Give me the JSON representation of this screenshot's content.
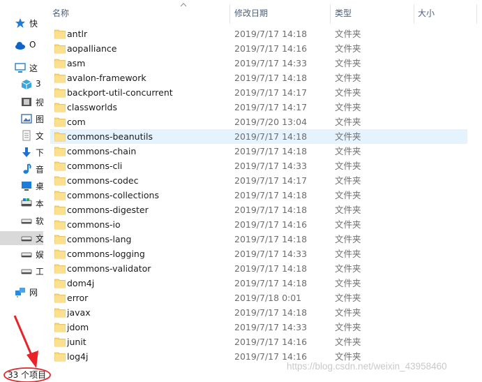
{
  "nav": {
    "items": [
      {
        "label": "快",
        "icon": "star-pin-icon",
        "color": "#1e7dd8"
      },
      {
        "label": "O",
        "icon": "onedrive-cloud-icon",
        "color": "#0f63c9"
      },
      {
        "label": "这",
        "icon": "this-pc-icon",
        "color": "#2b89d8"
      },
      {
        "label": "3",
        "icon": "3d-objects-icon",
        "color": "#39a5d8"
      },
      {
        "label": "视",
        "icon": "video-icon",
        "color": "#555555"
      },
      {
        "label": "图",
        "icon": "pictures-icon",
        "color": "#4a78b8"
      },
      {
        "label": "文",
        "icon": "documents-icon",
        "color": "#8c8c8c"
      },
      {
        "label": "下",
        "icon": "downloads-arrow-icon",
        "color": "#1e6fcf"
      },
      {
        "label": "音",
        "icon": "music-note-icon",
        "color": "#1e7dd8"
      },
      {
        "label": "桌",
        "icon": "desktop-icon",
        "color": "#1e7dd8"
      },
      {
        "label": "本",
        "icon": "local-disk-icon",
        "color": "#6d6d6d"
      },
      {
        "label": "软",
        "icon": "drive-icon",
        "color": "#6d6d6d"
      },
      {
        "label": "文",
        "icon": "drive-icon",
        "color": "#6d6d6d"
      },
      {
        "label": "娱",
        "icon": "drive-icon",
        "color": "#6d6d6d"
      },
      {
        "label": "工",
        "icon": "drive-icon",
        "color": "#6d6d6d"
      },
      {
        "label": "网",
        "icon": "network-icon",
        "color": "#2b89d8"
      }
    ]
  },
  "header": {
    "name": "名称",
    "date": "修改日期",
    "type": "类型",
    "size": "大小",
    "sort_icon": "sort-ascending-icon"
  },
  "files": [
    {
      "name": "antlr",
      "date": "2019/7/17 14:18",
      "type": "文件夹"
    },
    {
      "name": "aopalliance",
      "date": "2019/7/17 14:16",
      "type": "文件夹"
    },
    {
      "name": "asm",
      "date": "2019/7/17 14:33",
      "type": "文件夹"
    },
    {
      "name": "avalon-framework",
      "date": "2019/7/17 14:18",
      "type": "文件夹"
    },
    {
      "name": "backport-util-concurrent",
      "date": "2019/7/17 14:17",
      "type": "文件夹"
    },
    {
      "name": "classworlds",
      "date": "2019/7/17 14:17",
      "type": "文件夹"
    },
    {
      "name": "com",
      "date": "2019/7/20 13:04",
      "type": "文件夹"
    },
    {
      "name": "commons-beanutils",
      "date": "2019/7/17 14:18",
      "type": "文件夹"
    },
    {
      "name": "commons-chain",
      "date": "2019/7/17 14:18",
      "type": "文件夹"
    },
    {
      "name": "commons-cli",
      "date": "2019/7/17 14:33",
      "type": "文件夹"
    },
    {
      "name": "commons-codec",
      "date": "2019/7/17 14:17",
      "type": "文件夹"
    },
    {
      "name": "commons-collections",
      "date": "2019/7/17 14:18",
      "type": "文件夹"
    },
    {
      "name": "commons-digester",
      "date": "2019/7/17 14:18",
      "type": "文件夹"
    },
    {
      "name": "commons-io",
      "date": "2019/7/17 14:16",
      "type": "文件夹"
    },
    {
      "name": "commons-lang",
      "date": "2019/7/17 14:18",
      "type": "文件夹"
    },
    {
      "name": "commons-logging",
      "date": "2019/7/17 14:33",
      "type": "文件夹"
    },
    {
      "name": "commons-validator",
      "date": "2019/7/17 14:18",
      "type": "文件夹"
    },
    {
      "name": "dom4j",
      "date": "2019/7/17 14:18",
      "type": "文件夹"
    },
    {
      "name": "error",
      "date": "2019/7/18 0:01",
      "type": "文件夹"
    },
    {
      "name": "javax",
      "date": "2019/7/17 14:18",
      "type": "文件夹"
    },
    {
      "name": "jdom",
      "date": "2019/7/17 14:33",
      "type": "文件夹"
    },
    {
      "name": "junit",
      "date": "2019/7/17 14:16",
      "type": "文件夹"
    },
    {
      "name": "log4j",
      "date": "2019/7/17 14:16",
      "type": "文件夹"
    }
  ],
  "hovered_row": 7,
  "status": {
    "item_count": "33 个项目"
  },
  "watermark": "https://blog.csdn.net/weixin_43958460",
  "colors": {
    "folder": "#f8d775",
    "folder_dark": "#e8b84a",
    "hover_row": "#e5f3ff",
    "annotation": "#e8232a"
  }
}
